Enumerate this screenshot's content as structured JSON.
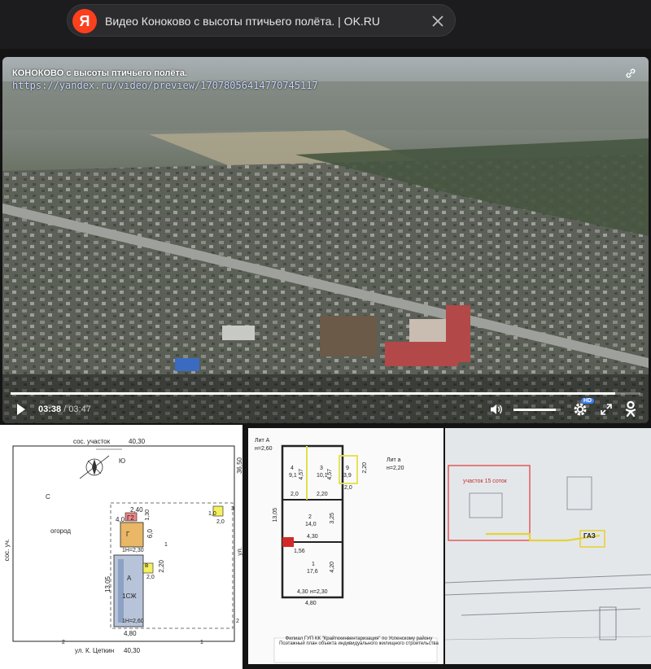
{
  "browser": {
    "tab_title": "Видео Коноково с высоты птичьего полёта. |  OK.RU",
    "logo_letter": "Я"
  },
  "video": {
    "title": "КОНОКОВО с высоты птичьего полёта.",
    "url": "https://yandex.ru/video/preview/17078056414770745117",
    "current_time": "03:38",
    "separator": " / ",
    "total_time": "03:47",
    "progress": 0.96,
    "volume": 0.9,
    "quality_badge": "HD"
  },
  "site_plan": {
    "top_label": "сос. участок",
    "top_width": "40,30",
    "bottom_street": "ул. К. Цеткин",
    "bottom_width": "40,30",
    "left_label": "сос. уч.",
    "right_label": "ул.",
    "right_len": "36,50",
    "left_len": "13,05",
    "garden": "огород",
    "compass_c": "С",
    "compass_yu": "Ю",
    "house": "А",
    "house_tag": "1СЖ",
    "g_label": "Г",
    "g2_label": "Г2",
    "v_label": "в",
    "d1": "2,40",
    "d2": "4,0",
    "d3": "1,30",
    "d4": "6,0",
    "d5": "2,20",
    "d6": "2,0",
    "d7": "4,80",
    "d8": "1Н=2,30",
    "d9": "1Н=2,60",
    "n1": "1,0",
    "n2": "2,0",
    "n3": "3",
    "n4": "1",
    "n5": "2",
    "n6": "2",
    "n7": "1"
  },
  "floor_plan": {
    "lit_a": "Лит А",
    "h_a": "н=2,60",
    "lit_a2": "Лит а",
    "h_a2": "н=2,20",
    "r4": "4",
    "r4a": "9,1",
    "r3": "3",
    "r3a": "10,1",
    "r9": "9",
    "r9a": "3,9",
    "r2": "2",
    "r2a": "14,0",
    "r1": "1",
    "r1a": "17,6",
    "w1": "2,0",
    "w2": "2,20",
    "w3": "2,0",
    "w4": "4,30",
    "w5": "4,30",
    "w6": "4,80",
    "h1": "13,05",
    "h2": "3,25",
    "h3": "4,20",
    "h4": "4,57",
    "h5": "4,57",
    "h6": "2,20",
    "x1": "1,56",
    "x2": "н=2,30",
    "caption1": "Филиал ГУП КК \"Крайтехинвентаризация\" по Успенскому району",
    "caption2": "Поэтажный план объекта индивидуального жилищного строительства"
  },
  "survey": {
    "note": "участок 15 соток",
    "gas": "ГАЗ"
  }
}
